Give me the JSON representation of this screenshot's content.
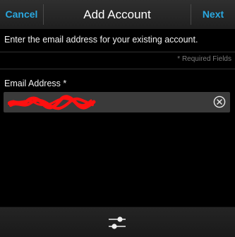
{
  "titlebar": {
    "cancel_label": "Cancel",
    "title": "Add Account",
    "next_label": "Next"
  },
  "instructions": "Enter the email address for your existing account.",
  "required_note": "* Required Fields",
  "email": {
    "label": "Email Address *",
    "value": ""
  },
  "icons": {
    "clear": "clear-circle-x-icon",
    "bottom": "sliders-icon"
  },
  "colors": {
    "accent": "#2aa8e0",
    "background": "#000000",
    "field": "#3a3a3a"
  }
}
